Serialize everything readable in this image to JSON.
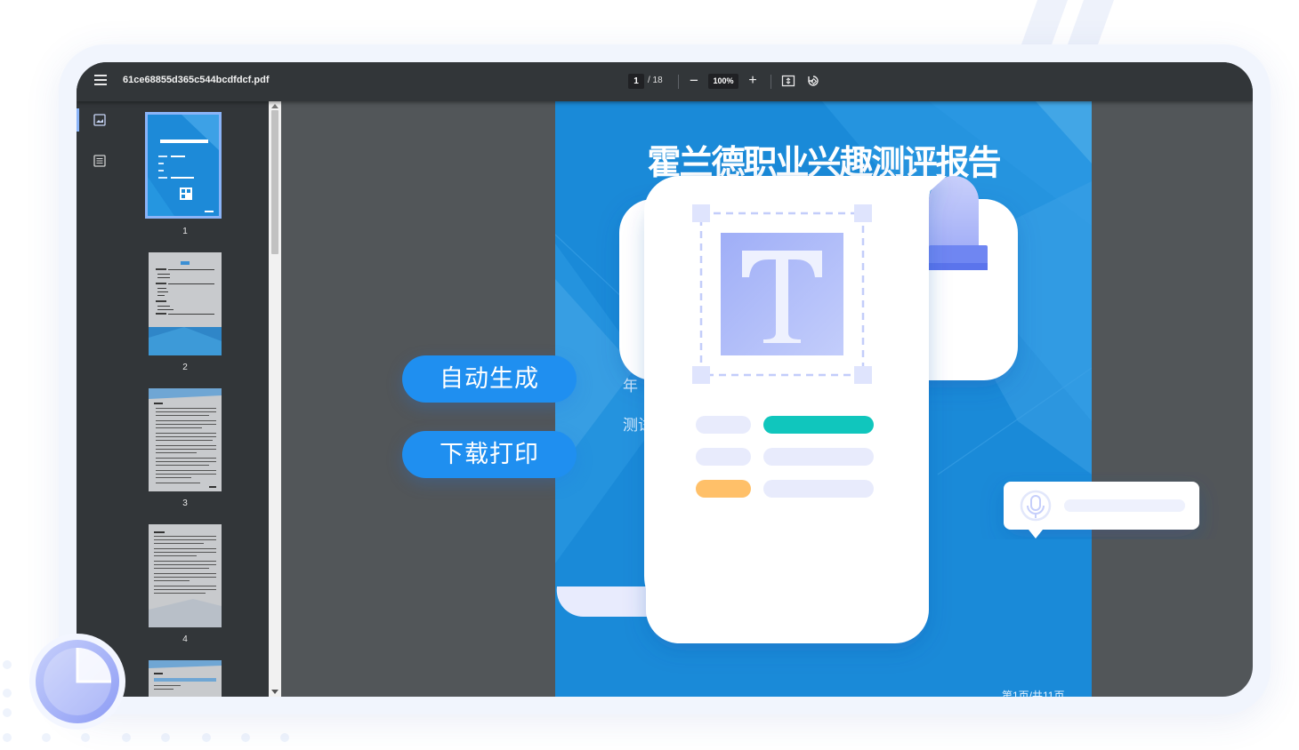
{
  "toolbar": {
    "file_name": "61ce68855d365c544bcdfdcf.pdf",
    "current_page": "1",
    "page_total": "/ 18",
    "zoom": "100%",
    "zoom_out_glyph": "−",
    "zoom_in_glyph": "+",
    "icons": [
      "menu-icon",
      "fit-page-icon",
      "rotate-icon"
    ]
  },
  "sidebar": {
    "tabs": [
      "thumbnails-icon",
      "outline-icon"
    ],
    "thumbnails": [
      {
        "label": "1",
        "active": true
      },
      {
        "label": "2",
        "active": false
      },
      {
        "label": "3",
        "active": false
      },
      {
        "label": "4",
        "active": false
      }
    ]
  },
  "document": {
    "title": "霍兰德职业兴趣测评报告",
    "partial_line_1": "年",
    "partial_line_2": "测试",
    "footer": "第1页/共11页"
  },
  "overlay": {
    "button_generate": "自动生成",
    "button_print": "下载打印",
    "card_icon": "microphone-icon",
    "paper_icon": "text-format-icon"
  },
  "colors": {
    "toolbar": "#323639",
    "viewer_bg": "#525659",
    "doc_blue": "#1a8ad8",
    "pill_blue": "#1f8ff0",
    "teal": "#10c6bd",
    "orange": "#ffc069",
    "lavender": "#b6c3fb"
  }
}
